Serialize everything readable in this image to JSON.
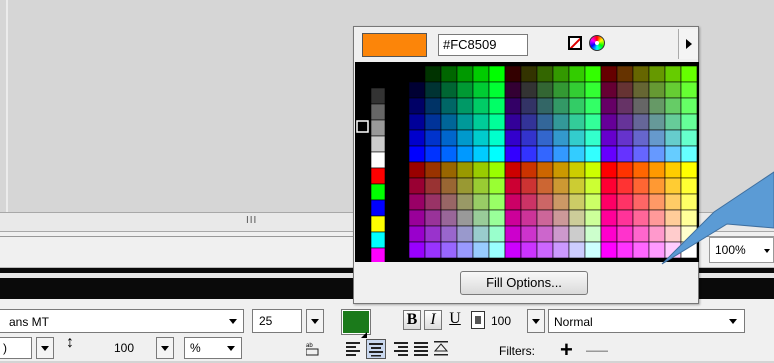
{
  "color_picker": {
    "hex_value": "#FC8509",
    "preview_color": "#FC8509",
    "fill_options_label": "Fill Options...",
    "icons": [
      "no-color-icon",
      "color-wheel-icon",
      "panel-menu-arrow-icon"
    ],
    "left_column_colors": [
      "#000000",
      "#333333",
      "#666666",
      "#999999",
      "#cccccc",
      "#ffffff",
      "#ff0000",
      "#00ff00",
      "#0000ff",
      "#ffff00",
      "#00ffff",
      "#ff00ff"
    ]
  },
  "scrollbar": {
    "grip": "III"
  },
  "zoom": {
    "value": "100%"
  },
  "properties": {
    "font_name": "ans MT",
    "font_size": "25",
    "text_color": "#1b7a1b",
    "bold_label": "B",
    "italic_label": "I",
    "underline_label": "U",
    "opacity_value": "100",
    "blend_mode": "Normal",
    "row2_left_value": ")",
    "line_spacing_value": "100",
    "unit": "%",
    "filters_label": "Filters:",
    "add_label": "+",
    "remove_label": "—"
  },
  "callout": {
    "fill_color": "#5b9bd5"
  }
}
